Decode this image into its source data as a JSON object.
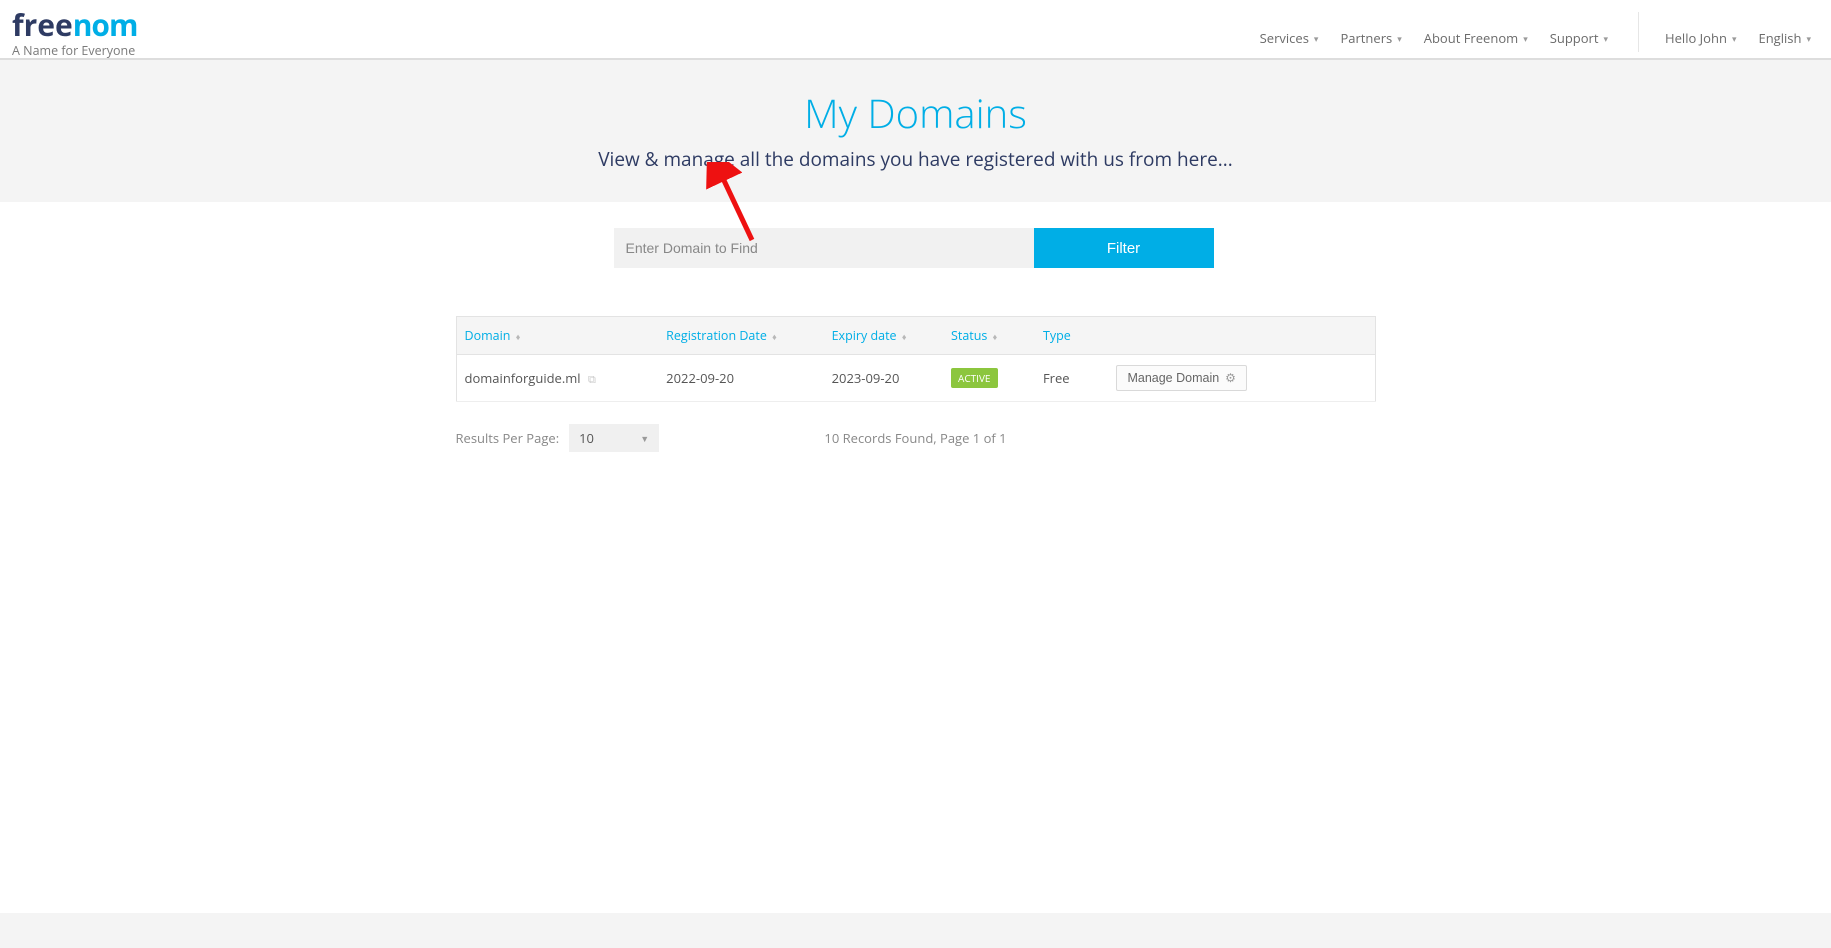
{
  "header": {
    "logo_free": "free",
    "logo_nom": "nom",
    "tagline": "A Name for Everyone",
    "nav": {
      "services": "Services",
      "partners": "Partners",
      "about": "About Freenom",
      "support": "Support",
      "hello": "Hello John",
      "lang": "English"
    }
  },
  "page": {
    "title": "My Domains",
    "subtitle": "View & manage all the domains you have registered with us from here..."
  },
  "filter": {
    "placeholder": "Enter Domain to Find",
    "button": "Filter"
  },
  "table": {
    "headers": {
      "domain": "Domain",
      "reg": "Registration Date",
      "exp": "Expiry date",
      "status": "Status",
      "type": "Type"
    },
    "rows": [
      {
        "domain": "domainforguide.ml",
        "reg": "2022-09-20",
        "exp": "2023-09-20",
        "status": "ACTIVE",
        "type": "Free",
        "action": "Manage Domain"
      }
    ]
  },
  "footer": {
    "rpp_label": "Results Per Page:",
    "rpp_value": "10",
    "records": "10 Records Found, Page 1 of 1"
  }
}
